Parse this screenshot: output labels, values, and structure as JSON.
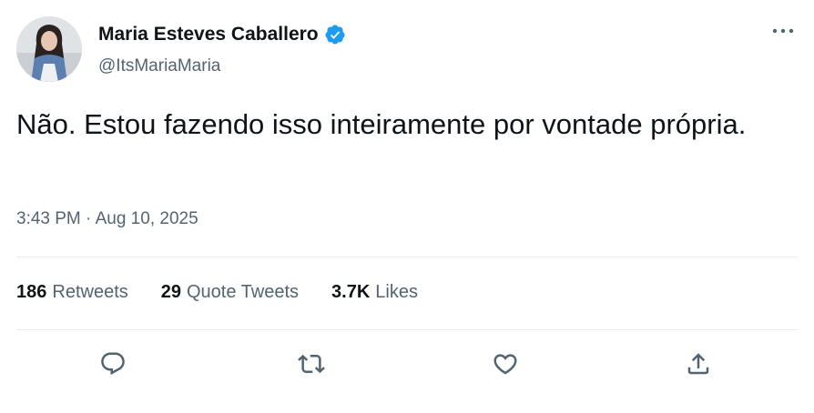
{
  "author": {
    "display_name": "Maria Esteves Caballero",
    "handle": "@ItsMariaMaria",
    "verified": true,
    "avatar": "profile-photo"
  },
  "tweet": {
    "text": "Não. Estou fazendo isso inteiramente por vontade própria.",
    "timestamp": "3:43 PM · Aug 10, 2025"
  },
  "stats": {
    "retweets_count": "186",
    "retweets_label": "Retweets",
    "quotes_count": "29",
    "quotes_label": "Quote Tweets",
    "likes_count": "3.7K",
    "likes_label": "Likes"
  },
  "icons": {
    "more": "more-horizontal-icon",
    "verified": "verified-badge-icon",
    "reply": "reply-icon",
    "retweet": "retweet-icon",
    "like": "heart-icon",
    "share": "share-icon"
  },
  "colors": {
    "text_primary": "#0f1419",
    "text_secondary": "#536471",
    "verified_blue": "#1d9bf0",
    "icon_gray": "#536471",
    "divider": "#e6ecf0"
  }
}
